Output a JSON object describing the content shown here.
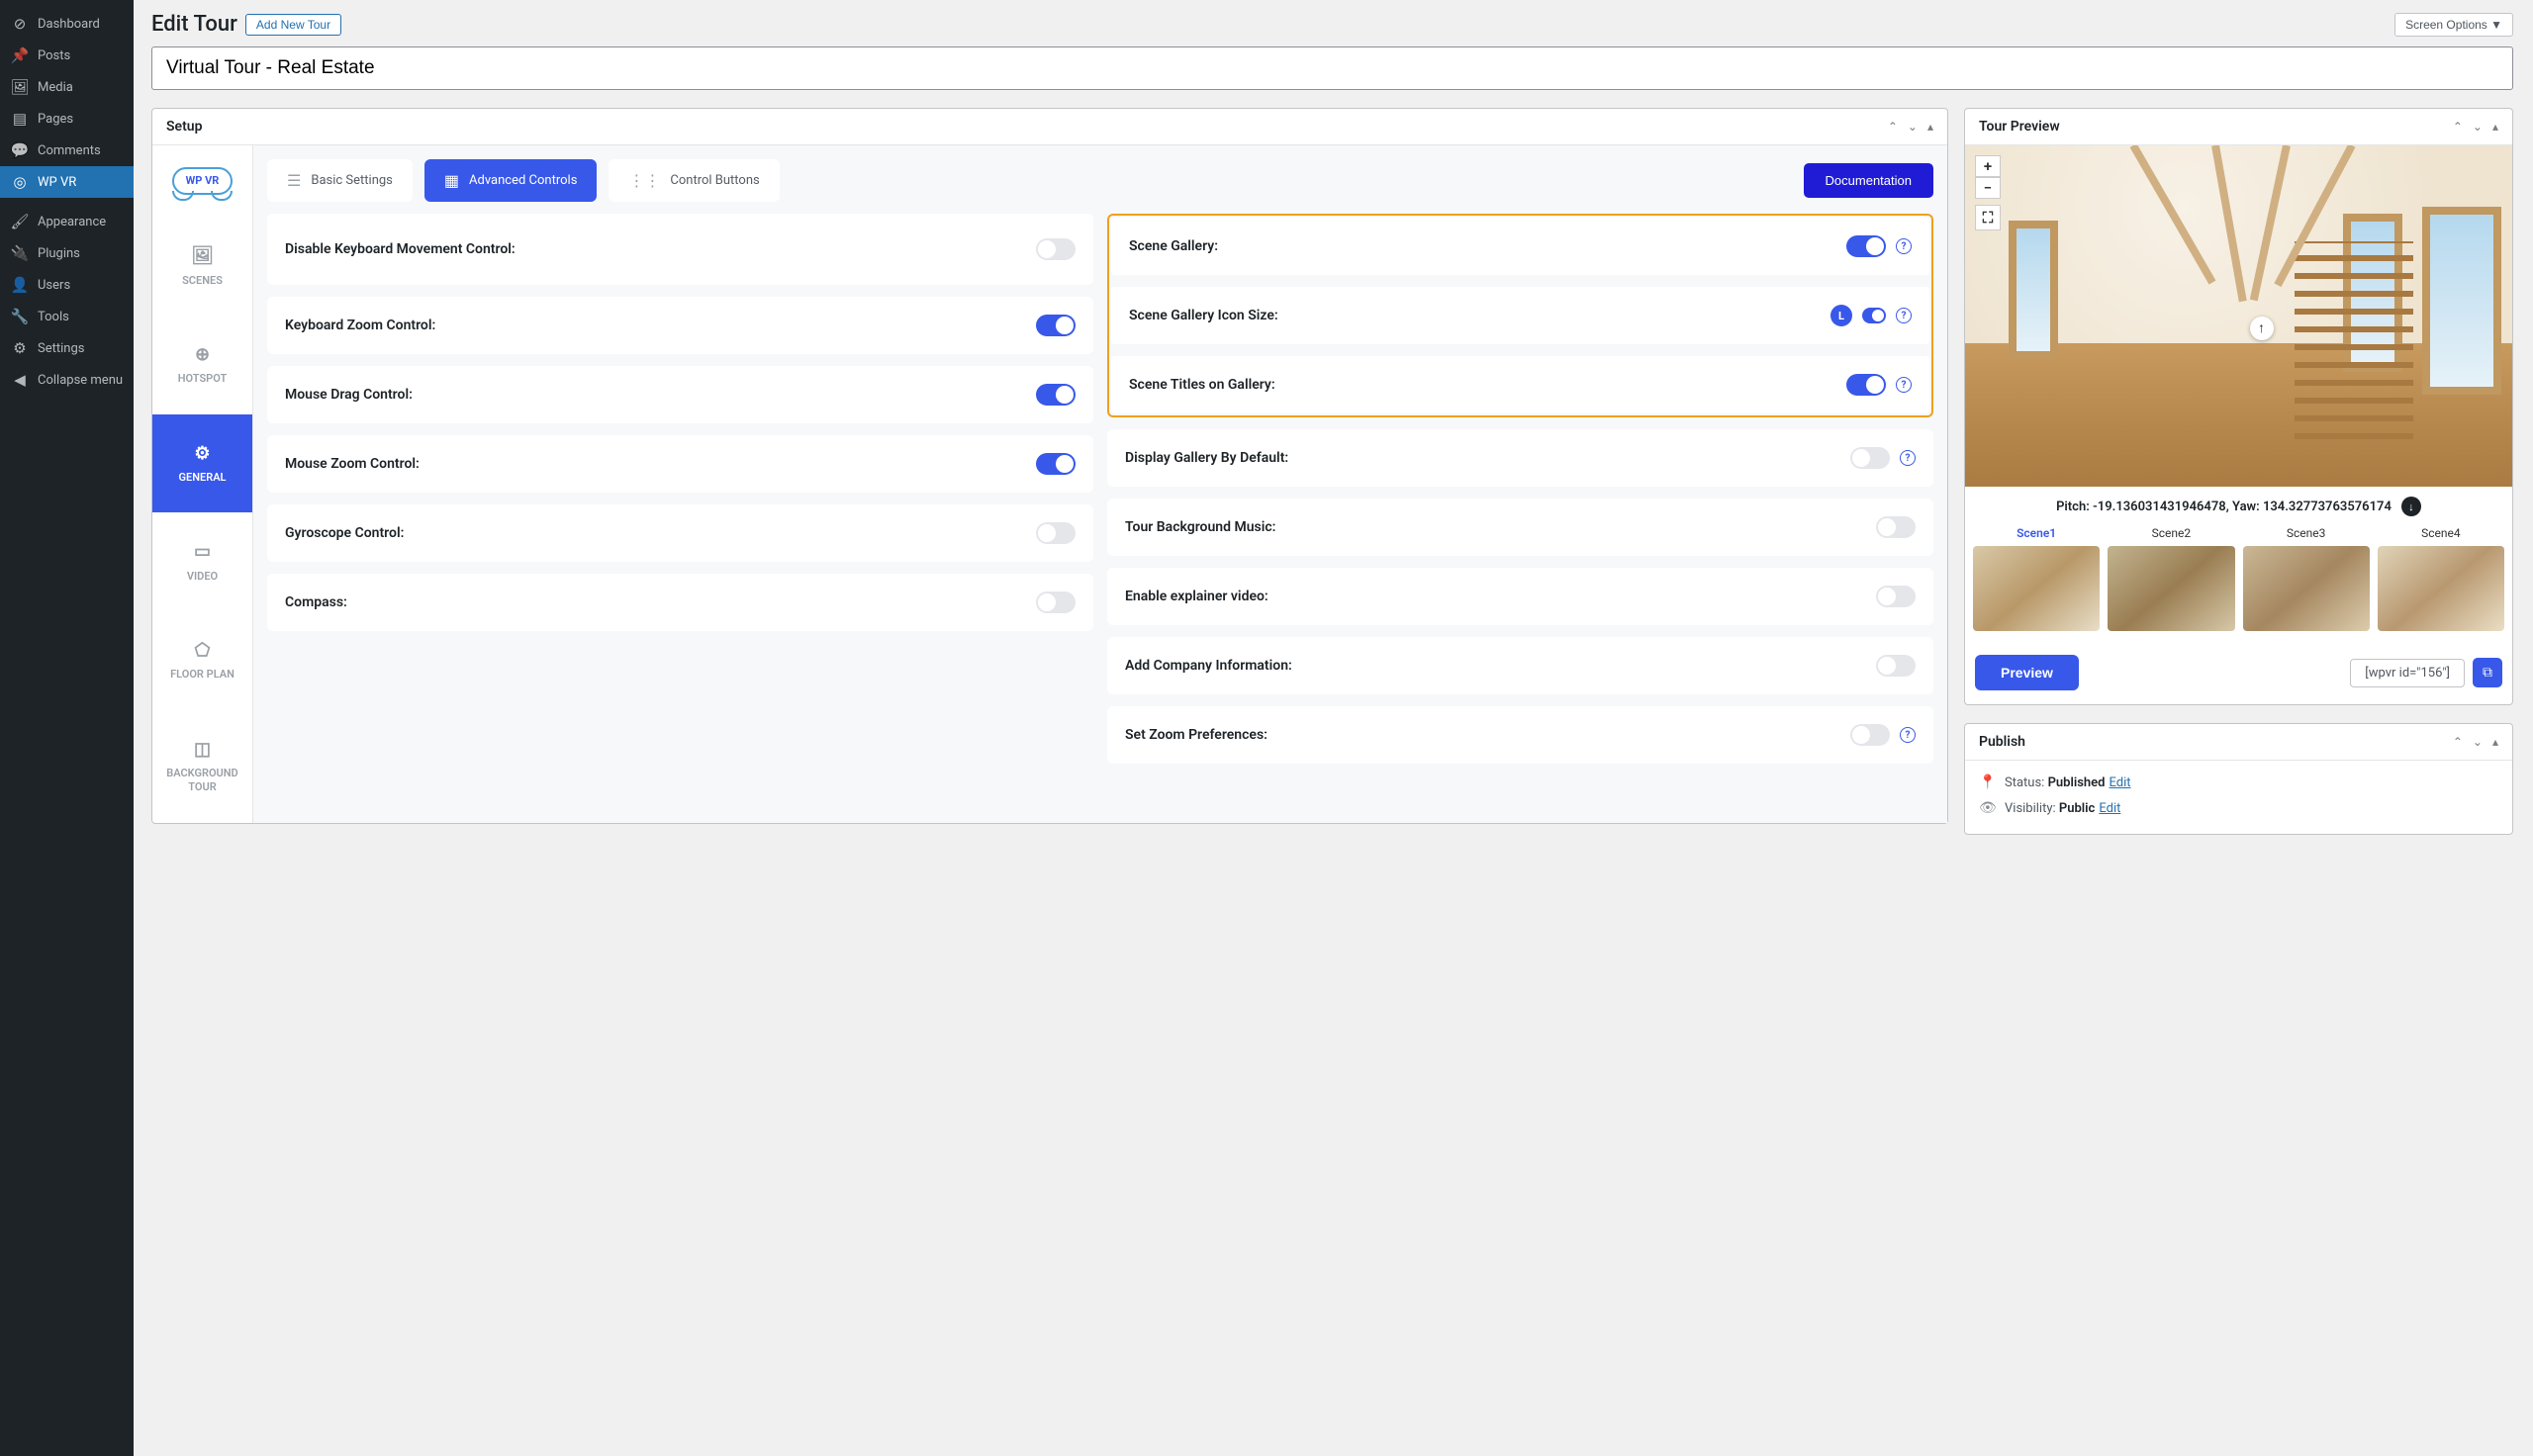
{
  "admin_nav": {
    "dashboard": "Dashboard",
    "posts": "Posts",
    "media": "Media",
    "pages": "Pages",
    "comments": "Comments",
    "wpvr": "WP VR",
    "appearance": "Appearance",
    "plugins": "Plugins",
    "users": "Users",
    "tools": "Tools",
    "settings": "Settings",
    "collapse": "Collapse menu"
  },
  "header": {
    "title": "Edit Tour",
    "add_new": "Add New Tour",
    "screen_options": "Screen Options ▼",
    "tour_title": "Virtual Tour - Real Estate"
  },
  "setup": {
    "title": "Setup",
    "side_tabs": {
      "logo": "WP VR",
      "scenes": "SCENES",
      "hotspot": "HOTSPOT",
      "general": "GENERAL",
      "video": "VIDEO",
      "floor_plan": "FLOOR PLAN",
      "background_tour": "BACKGROUND TOUR"
    },
    "tabs": {
      "basic": "Basic Settings",
      "advanced": "Advanced Controls",
      "control_buttons": "Control Buttons",
      "documentation": "Documentation"
    },
    "controls_left": {
      "disable_keyboard": "Disable Keyboard Movement Control:",
      "keyboard_zoom": "Keyboard Zoom Control:",
      "mouse_drag": "Mouse Drag Control:",
      "mouse_zoom": "Mouse Zoom Control:",
      "gyroscope": "Gyroscope Control:",
      "compass": "Compass:"
    },
    "controls_right": {
      "scene_gallery": "Scene Gallery:",
      "scene_gallery_icon_size": "Scene Gallery Icon Size:",
      "scene_gallery_icon_badge": "L",
      "scene_titles": "Scene Titles on Gallery:",
      "display_gallery_default": "Display Gallery By Default:",
      "tour_bg_music": "Tour Background Music:",
      "enable_explainer": "Enable explainer video:",
      "add_company": "Add Company Information:",
      "set_zoom": "Set Zoom Preferences:"
    }
  },
  "preview": {
    "title": "Tour Preview",
    "pitch_label": "Pitch:",
    "pitch_value": "-19.136031431946478",
    "yaw_label": "Yaw:",
    "yaw_value": "134.32773763576174",
    "scenes": [
      "Scene1",
      "Scene2",
      "Scene3",
      "Scene4"
    ],
    "preview_btn": "Preview",
    "shortcode": "[wpvr id=\"156\"]"
  },
  "publish": {
    "title": "Publish",
    "status_label": "Status:",
    "status_value": "Published",
    "visibility_label": "Visibility:",
    "visibility_value": "Public",
    "edit": "Edit"
  }
}
